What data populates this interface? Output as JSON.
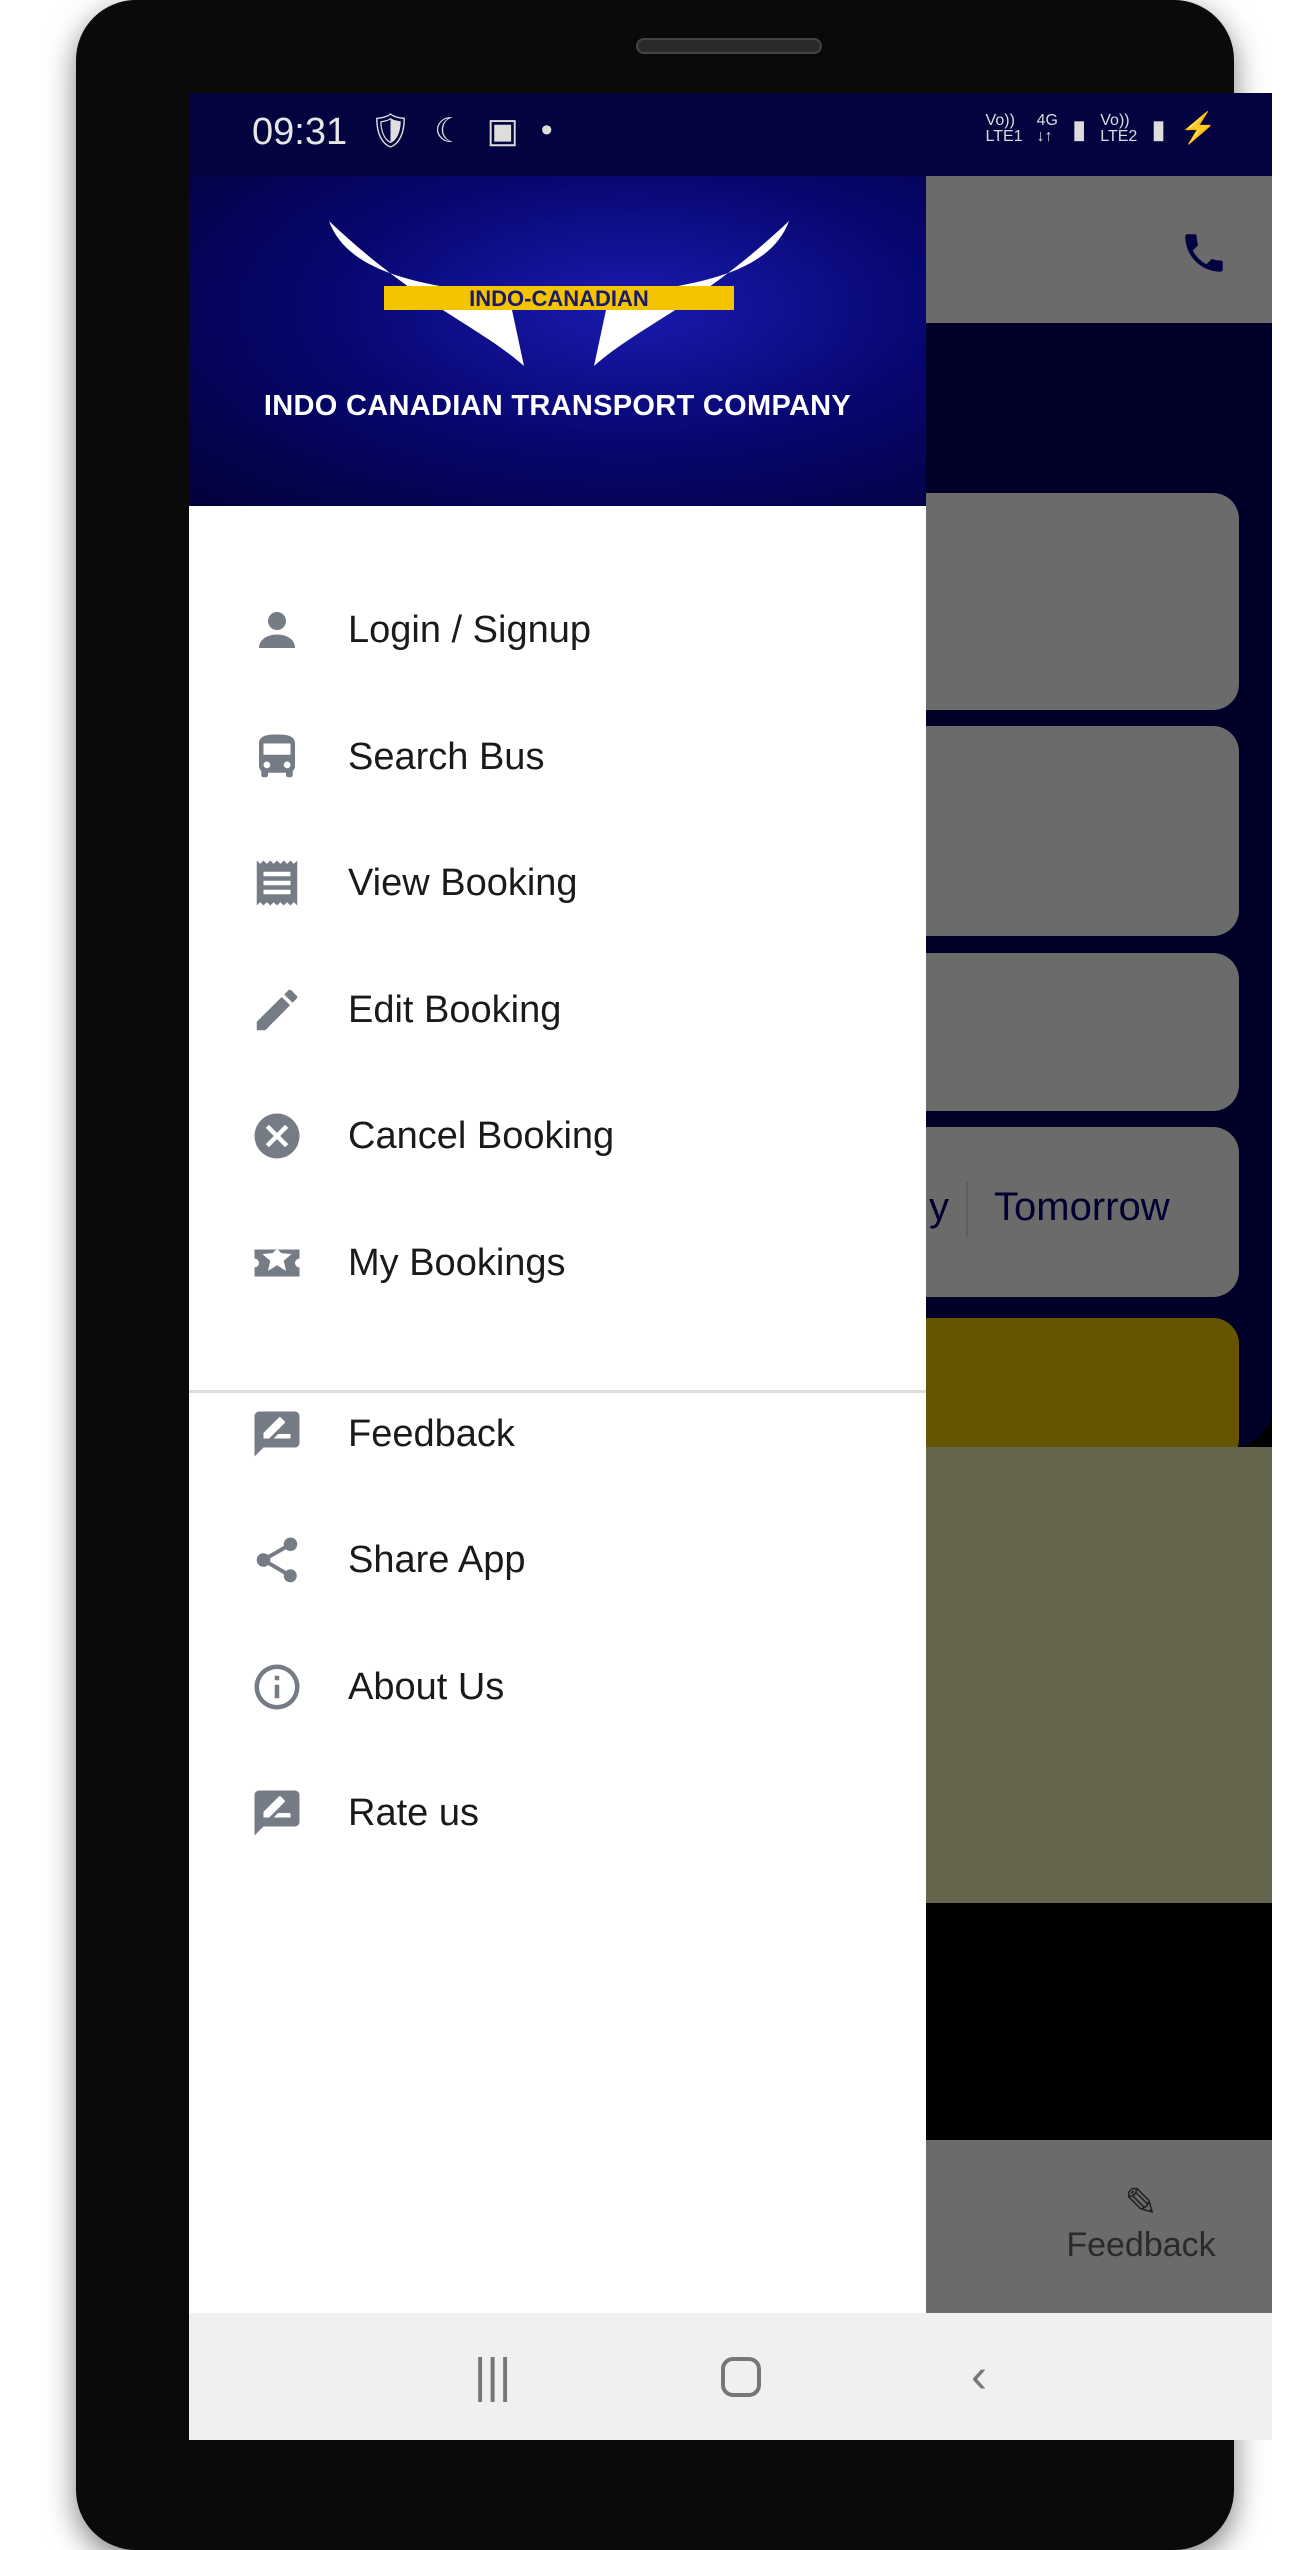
{
  "status_bar": {
    "time": "09:31",
    "dot": "•",
    "sim1_top": "Vo))",
    "sim1_bottom": "LTE1",
    "net_top": "4G",
    "net_bottom": "↓↑",
    "sim2_top": "Vo))",
    "sim2_bottom": "LTE2"
  },
  "drawer": {
    "logo_text": "INDO-CANADIAN",
    "company_name": "INDO CANADIAN TRANSPORT COMPANY",
    "items": [
      {
        "label": "Login / Signup",
        "icon": "person-icon"
      },
      {
        "label": "Search Bus",
        "icon": "bus-icon"
      },
      {
        "label": "View Booking",
        "icon": "receipt-icon"
      },
      {
        "label": "Edit Booking",
        "icon": "pencil-icon"
      },
      {
        "label": "Cancel Booking",
        "icon": "cancel-icon"
      },
      {
        "label": "My Bookings",
        "icon": "ticket-star-icon"
      }
    ],
    "secondary_items": [
      {
        "label": "Feedback",
        "icon": "feedback-icon"
      },
      {
        "label": "Share App",
        "icon": "share-icon"
      },
      {
        "label": "About Us",
        "icon": "info-icon"
      },
      {
        "label": "Rate us",
        "icon": "rate-icon"
      }
    ]
  },
  "background": {
    "tomorrow": "Tomorrow",
    "today_partial": "y",
    "bottom_nav_feedback": "Feedback"
  },
  "colors": {
    "navy": "#000029",
    "accent_yellow": "#665500",
    "icon_gray": "#757c85"
  }
}
